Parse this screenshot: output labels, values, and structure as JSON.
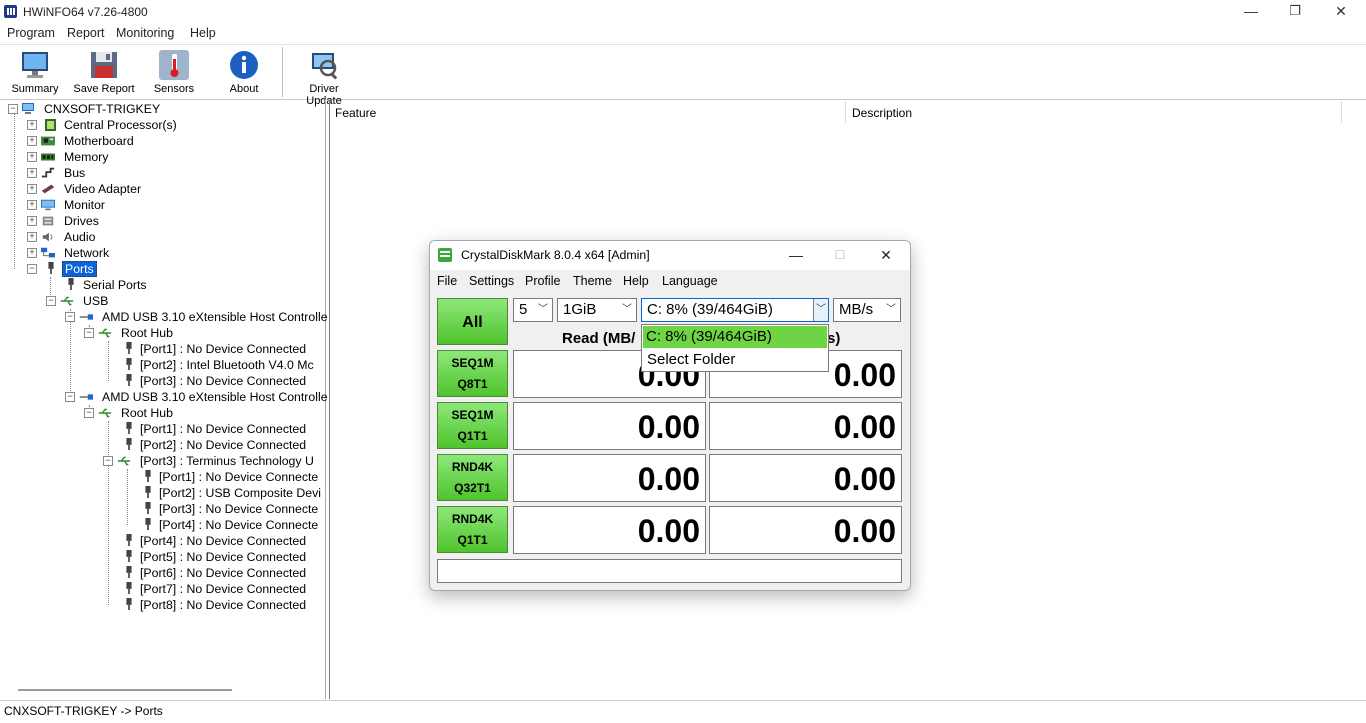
{
  "window": {
    "title": "HWiNFO64 v7.26-4800",
    "minimize_glyph": "—",
    "restore_glyph": "❐",
    "close_glyph": "✕"
  },
  "menubar": [
    "Program",
    "Report",
    "Monitoring",
    "Help"
  ],
  "toolbar": [
    {
      "label": "Summary",
      "icon": "monitor-icon"
    },
    {
      "label": "Save Report",
      "icon": "floppy-disk-icon"
    },
    {
      "label": "Sensors",
      "icon": "thermometer-icon"
    },
    {
      "label": "About",
      "icon": "info-icon"
    },
    {
      "label": "Driver Update",
      "icon": "driver-update-icon"
    }
  ],
  "tree": {
    "root": "CNXSOFT-TRIGKEY",
    "categories": [
      "Central Processor(s)",
      "Motherboard",
      "Memory",
      "Bus",
      "Video Adapter",
      "Monitor",
      "Drives",
      "Audio",
      "Network"
    ],
    "ports": {
      "label": "Ports",
      "serial": "Serial Ports",
      "usb": "USB",
      "controller1": "AMD USB 3.10 eXtensible Host Controlle",
      "controller1_hub": "Root Hub",
      "controller1_ports": [
        "[Port1] : No Device Connected",
        "[Port2] : Intel Bluetooth V4.0 Mc",
        "[Port3] : No Device Connected"
      ],
      "controller2": "AMD USB 3.10 eXtensible Host Controlle",
      "controller2_hub": "Root Hub",
      "controller2_ports_a": [
        "[Port1] : No Device Connected",
        "[Port2] : No Device Connected"
      ],
      "controller2_port3": "[Port3] : Terminus Technology U",
      "hub_ports": [
        "[Port1] : No Device Connecte",
        "[Port2] : USB Composite Devi",
        "[Port3] : No Device Connecte",
        "[Port4] : No Device Connecte"
      ],
      "controller2_ports_b": [
        "[Port4] : No Device Connected",
        "[Port5] : No Device Connected",
        "[Port6] : No Device Connected",
        "[Port7] : No Device Connected",
        "[Port8] : No Device Connected"
      ]
    }
  },
  "details": {
    "col_feature": "Feature",
    "col_description": "Description"
  },
  "status": "CNXSOFT-TRIGKEY -> Ports",
  "cdm": {
    "title": "CrystalDiskMark 8.0.4 x64 [Admin]",
    "menu": [
      "File",
      "Settings",
      "Profile",
      "Theme",
      "Help",
      "Language"
    ],
    "all_label": "All",
    "count": "5",
    "size": "1GiB",
    "drive": "C: 8% (39/464GiB)",
    "unit": "MB/s",
    "read_header": "Read (MB/",
    "write_header": "B/s)",
    "dropdown_options": [
      "C: 8% (39/464GiB)",
      "Select Folder"
    ],
    "tests": [
      {
        "line1": "SEQ1M",
        "line2": "Q8T1",
        "read": "0.00",
        "write": "0.00"
      },
      {
        "line1": "SEQ1M",
        "line2": "Q1T1",
        "read": "0.00",
        "write": "0.00"
      },
      {
        "line1": "RND4K",
        "line2": "Q32T1",
        "read": "0.00",
        "write": "0.00"
      },
      {
        "line1": "RND4K",
        "line2": "Q1T1",
        "read": "0.00",
        "write": "0.00"
      }
    ],
    "comment": ""
  }
}
